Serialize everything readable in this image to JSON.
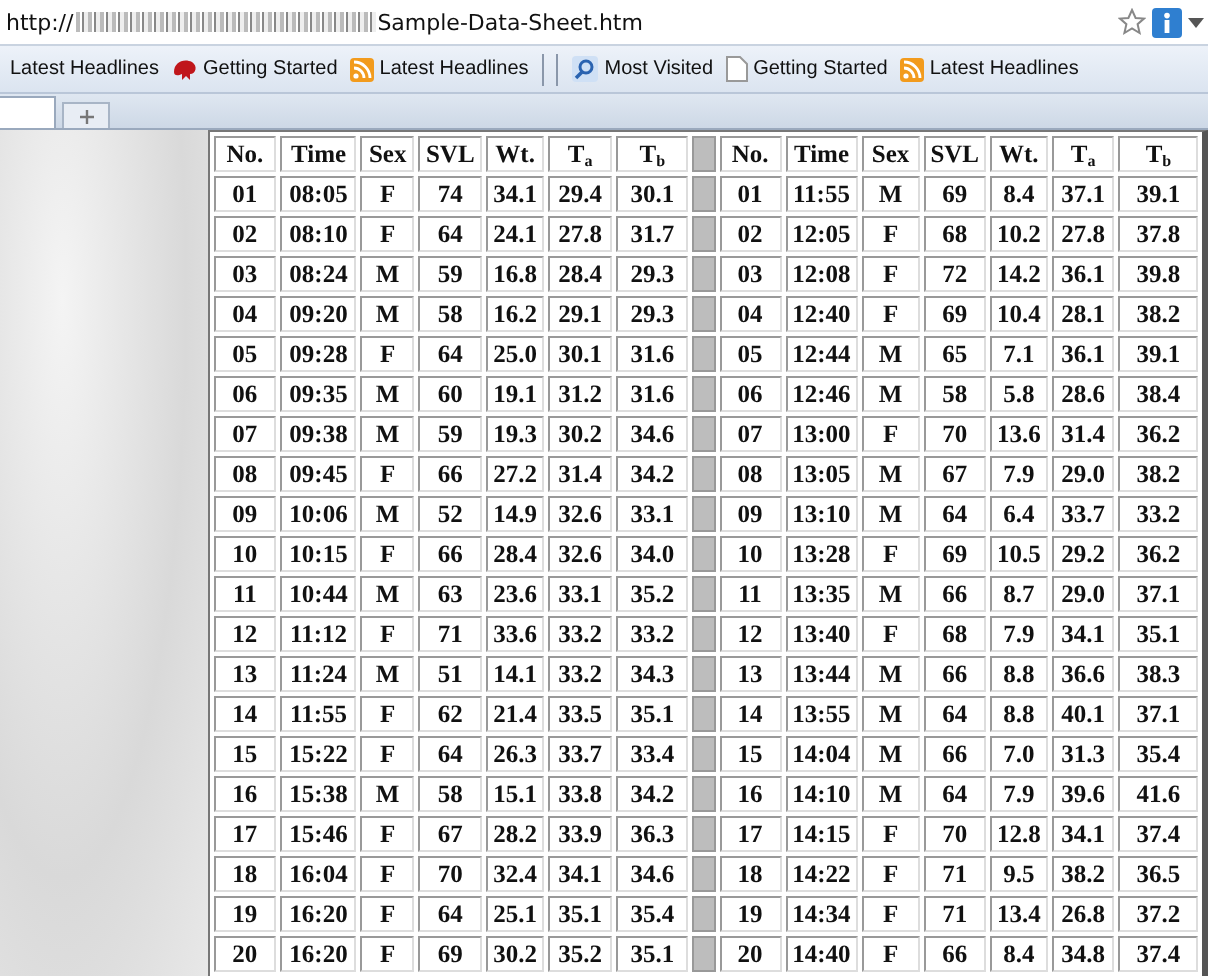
{
  "address_bar": {
    "url_start": "http://",
    "url_end": "Sample-Data-Sheet.htm"
  },
  "bookmarks": [
    {
      "kind": "plain",
      "label": "Latest Headlines"
    },
    {
      "kind": "creature",
      "label": "Getting Started"
    },
    {
      "kind": "feed",
      "label": "Latest Headlines"
    },
    {
      "kind": "separator"
    },
    {
      "kind": "globe",
      "label": "Most Visited"
    },
    {
      "kind": "page",
      "label": "Getting Started"
    },
    {
      "kind": "feed",
      "label": "Latest Headlines"
    }
  ],
  "tables": [
    {
      "columns": [
        "No.",
        "Time",
        "Sex",
        "SVL",
        "Wt.",
        "T$_{a}$",
        "T$_{b}$"
      ],
      "rows": [
        [
          "01",
          "08:05",
          "F",
          "74",
          "34.1",
          "29.4",
          "30.1"
        ],
        [
          "02",
          "08:10",
          "F",
          "64",
          "24.1",
          "27.8",
          "31.7"
        ],
        [
          "03",
          "08:24",
          "M",
          "59",
          "16.8",
          "28.4",
          "29.3"
        ],
        [
          "04",
          "09:20",
          "M",
          "58",
          "16.2",
          "29.1",
          "29.3"
        ],
        [
          "05",
          "09:28",
          "F",
          "64",
          "25.0",
          "30.1",
          "31.6"
        ],
        [
          "06",
          "09:35",
          "M",
          "60",
          "19.1",
          "31.2",
          "31.6"
        ],
        [
          "07",
          "09:38",
          "M",
          "59",
          "19.3",
          "30.2",
          "34.6"
        ],
        [
          "08",
          "09:45",
          "F",
          "66",
          "27.2",
          "31.4",
          "34.2"
        ],
        [
          "09",
          "10:06",
          "M",
          "52",
          "14.9",
          "32.6",
          "33.1"
        ],
        [
          "10",
          "10:15",
          "F",
          "66",
          "28.4",
          "32.6",
          "34.0"
        ],
        [
          "11",
          "10:44",
          "M",
          "63",
          "23.6",
          "33.1",
          "35.2"
        ],
        [
          "12",
          "11:12",
          "F",
          "71",
          "33.6",
          "33.2",
          "33.2"
        ],
        [
          "13",
          "11:24",
          "M",
          "51",
          "14.1",
          "33.2",
          "34.3"
        ],
        [
          "14",
          "11:55",
          "F",
          "62",
          "21.4",
          "33.5",
          "35.1"
        ],
        [
          "15",
          "15:22",
          "F",
          "64",
          "26.3",
          "33.7",
          "33.4"
        ],
        [
          "16",
          "15:38",
          "M",
          "58",
          "15.1",
          "33.8",
          "34.2"
        ],
        [
          "17",
          "15:46",
          "F",
          "67",
          "28.2",
          "33.9",
          "36.3"
        ],
        [
          "18",
          "16:04",
          "F",
          "70",
          "32.4",
          "34.1",
          "34.6"
        ],
        [
          "19",
          "16:20",
          "F",
          "64",
          "25.1",
          "35.1",
          "35.4"
        ],
        [
          "20",
          "16:20",
          "F",
          "69",
          "30.2",
          "35.2",
          "35.1"
        ]
      ]
    },
    {
      "columns": [
        "No.",
        "Time",
        "Sex",
        "SVL",
        "Wt.",
        "T$_{a}$",
        "T$_{b}$"
      ],
      "rows": [
        [
          "01",
          "11:55",
          "M",
          "69",
          "8.4",
          "37.1",
          "39.1"
        ],
        [
          "02",
          "12:05",
          "F",
          "68",
          "10.2",
          "27.8",
          "37.8"
        ],
        [
          "03",
          "12:08",
          "F",
          "72",
          "14.2",
          "36.1",
          "39.8"
        ],
        [
          "04",
          "12:40",
          "F",
          "69",
          "10.4",
          "28.1",
          "38.2"
        ],
        [
          "05",
          "12:44",
          "M",
          "65",
          "7.1",
          "36.1",
          "39.1"
        ],
        [
          "06",
          "12:46",
          "M",
          "58",
          "5.8",
          "28.6",
          "38.4"
        ],
        [
          "07",
          "13:00",
          "F",
          "70",
          "13.6",
          "31.4",
          "36.2"
        ],
        [
          "08",
          "13:05",
          "M",
          "67",
          "7.9",
          "29.0",
          "38.2"
        ],
        [
          "09",
          "13:10",
          "M",
          "64",
          "6.4",
          "33.7",
          "33.2"
        ],
        [
          "10",
          "13:28",
          "F",
          "69",
          "10.5",
          "29.2",
          "36.2"
        ],
        [
          "11",
          "13:35",
          "M",
          "66",
          "8.7",
          "29.0",
          "37.1"
        ],
        [
          "12",
          "13:40",
          "F",
          "68",
          "7.9",
          "34.1",
          "35.1"
        ],
        [
          "13",
          "13:44",
          "M",
          "66",
          "8.8",
          "36.6",
          "38.3"
        ],
        [
          "14",
          "13:55",
          "M",
          "64",
          "8.8",
          "40.1",
          "37.1"
        ],
        [
          "15",
          "14:04",
          "M",
          "66",
          "7.0",
          "31.3",
          "35.4"
        ],
        [
          "16",
          "14:10",
          "M",
          "64",
          "7.9",
          "39.6",
          "41.6"
        ],
        [
          "17",
          "14:15",
          "F",
          "70",
          "12.8",
          "34.1",
          "37.4"
        ],
        [
          "18",
          "14:22",
          "F",
          "71",
          "9.5",
          "38.2",
          "36.5"
        ],
        [
          "19",
          "14:34",
          "F",
          "71",
          "13.4",
          "26.8",
          "37.2"
        ],
        [
          "20",
          "14:40",
          "F",
          "66",
          "8.4",
          "34.8",
          "37.4"
        ]
      ]
    }
  ]
}
